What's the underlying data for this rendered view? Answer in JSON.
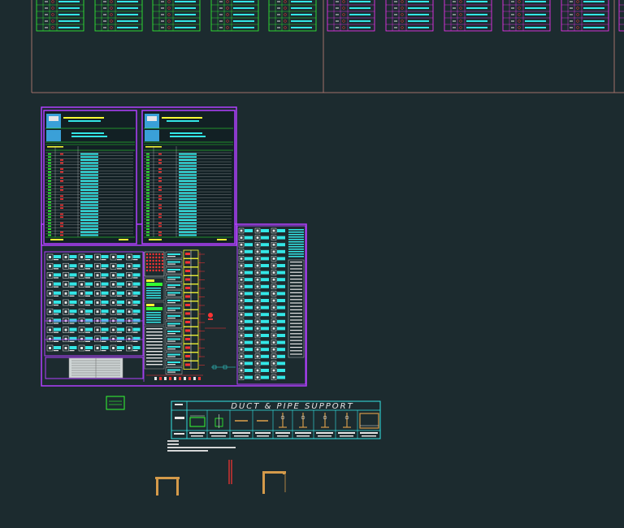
{
  "drawing": {
    "background": "#1c2b2f",
    "colors": {
      "green": "#33ff33",
      "magenta": "#ff33ff",
      "cyan": "#33e6e6",
      "yellow": "#ffff33",
      "red": "#ff3333",
      "white": "#e6e6e6",
      "purple": "#b040ff",
      "orange": "#d49a4a",
      "frame": "#a0706a"
    }
  },
  "duct_support": {
    "title": "DUCT & PIPE SUPPORT"
  }
}
